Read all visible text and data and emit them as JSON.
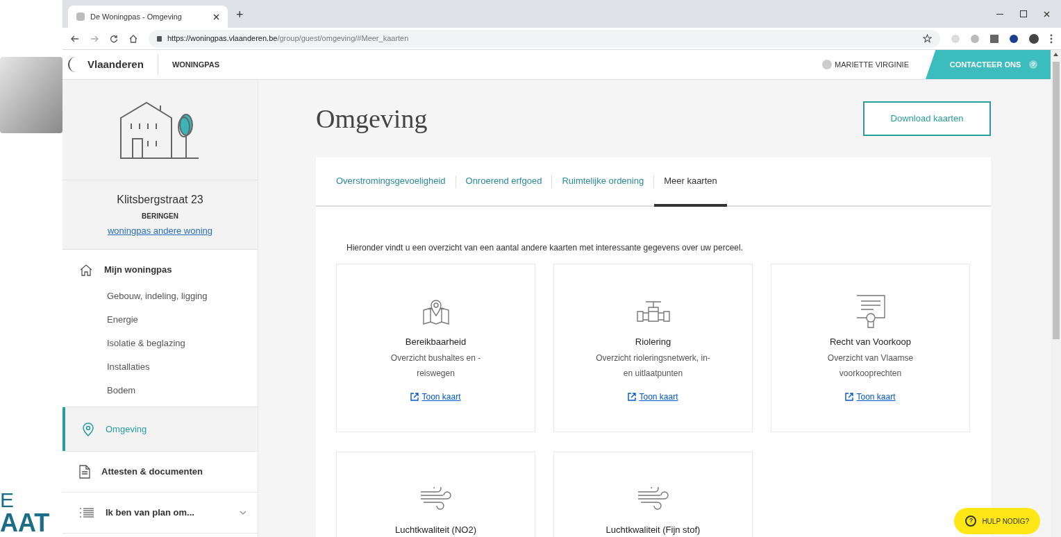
{
  "backdrop": {
    "lines": [
      "E",
      "AAT"
    ]
  },
  "browser": {
    "tab_title": "De Woningpas - Omgeving",
    "new_tab": "+",
    "url_host": "https://woningpas.vlaanderen.be",
    "url_path": "/group/guest/omgeving/#Meer_kaarten"
  },
  "header": {
    "brand": "Vlaanderen",
    "app": "WONINGPAS",
    "user": "MARIETTE VIRGINIE",
    "contact": "CONTACTEER ONS",
    "contact_badge": "?"
  },
  "sidebar": {
    "address": "Klitsbergstraat 23",
    "city": "BERINGEN",
    "other_link": "woningpas andere woning",
    "sections": [
      {
        "kind": "home",
        "label": "Mijn woningpas",
        "selected": false,
        "children": [
          {
            "label": "Gebouw, indeling, ligging"
          },
          {
            "label": "Energie"
          },
          {
            "label": "Isolatie & beglazing"
          },
          {
            "label": "Installaties"
          },
          {
            "label": "Bodem"
          }
        ]
      },
      {
        "kind": "pin",
        "label": "Omgeving",
        "selected": true
      },
      {
        "kind": "document",
        "label": "Attesten & documenten",
        "selected": false
      },
      {
        "kind": "list",
        "label": "Ik ben van plan om...",
        "selected": false,
        "expanded": false
      }
    ]
  },
  "main": {
    "title": "Omgeving",
    "download": "Download kaarten",
    "tabs": [
      {
        "label": "Overstromingsgevoeligheid",
        "selected": false
      },
      {
        "label": "Onroerend erfgoed",
        "selected": false
      },
      {
        "label": "Ruimtelijke ordening",
        "selected": false
      },
      {
        "label": "Meer kaarten",
        "selected": true
      }
    ],
    "intro": "Hieronder vindt u een overzicht van een aantal andere kaarten met interessante gegevens over uw perceel.",
    "cards": [
      {
        "kind": "map",
        "title": "Bereikbaarheid",
        "description": [
          "Overzicht bushaltes en -",
          "reiswegen"
        ],
        "link": "Toon kaart"
      },
      {
        "kind": "pipe",
        "title": "Riolering",
        "description": [
          "Overzicht rioleringsnetwerk, in-",
          "en uitlaatpunten"
        ],
        "link": "Toon kaart"
      },
      {
        "kind": "certificate",
        "title": "Recht van Voorkoop",
        "description": [
          "Overzicht van Vlaamse",
          "voorkooprechten"
        ],
        "link": "Toon kaart"
      },
      {
        "kind": "wind",
        "title": "Luchtkwaliteit (NO2)"
      },
      {
        "kind": "wind",
        "title": "Luchtkwaliteit (Fijn stof)"
      }
    ]
  },
  "help": {
    "icon": "?",
    "label": "HULP NODIG?"
  }
}
